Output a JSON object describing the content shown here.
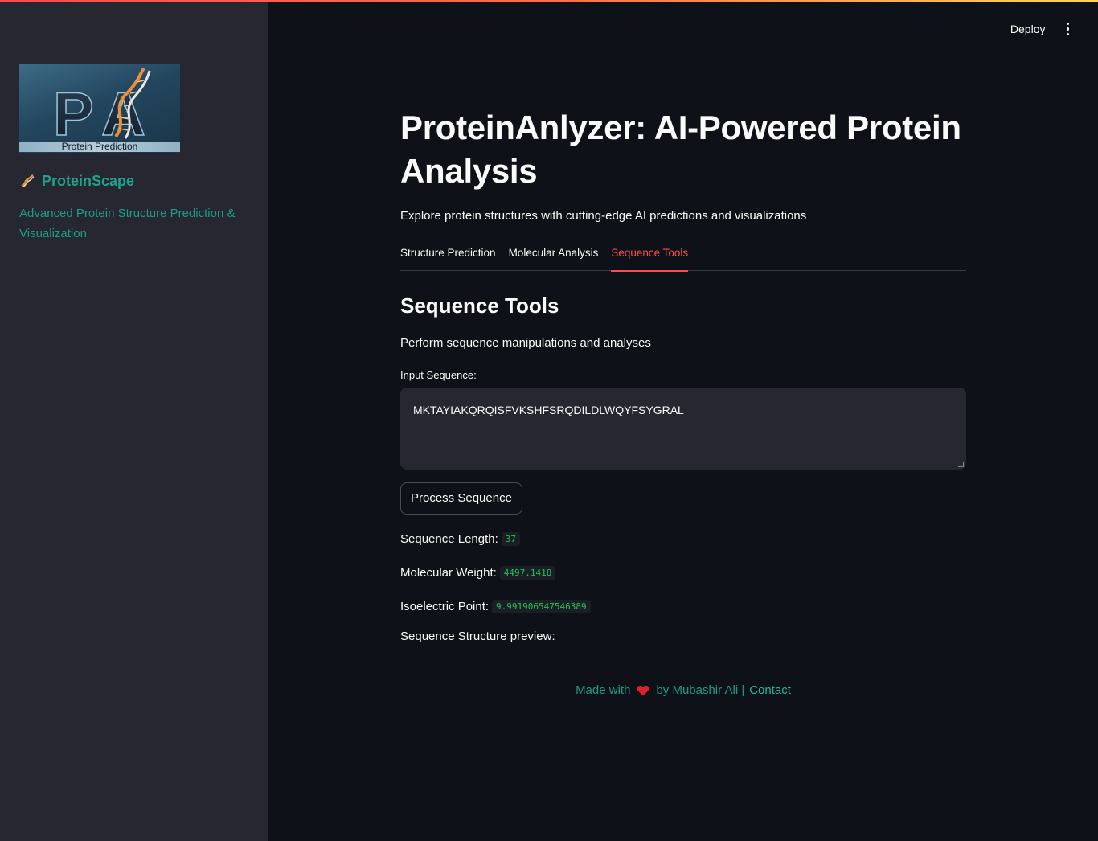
{
  "header": {
    "deploy_label": "Deploy",
    "menu_icon": "kebab-menu-icon"
  },
  "sidebar": {
    "logo_caption": "Protein Prediction",
    "logo_letters": "PA",
    "brand_icon": "dna-icon",
    "brand_name": "ProteinScape",
    "tagline": "Advanced Protein Structure Prediction & Visualization"
  },
  "main": {
    "title": "ProteinAnlyzer: AI-Powered Protein Analysis",
    "subtitle": "Explore protein structures with cutting-edge AI predictions and visualizations",
    "tabs": [
      {
        "label": "Structure Prediction",
        "active": false
      },
      {
        "label": "Molecular Analysis",
        "active": false
      },
      {
        "label": "Sequence Tools",
        "active": true
      }
    ],
    "section_title": "Sequence Tools",
    "section_subtitle": "Perform sequence manipulations and analyses",
    "input_label": "Input Sequence:",
    "input_value": "MKTAYIAKQRQISFVKSHFSRQDILDLWQYFSYGRAL",
    "process_button": "Process Sequence",
    "stats": {
      "length_label": "Sequence Length:",
      "length_value": "37",
      "weight_label": "Molecular Weight:",
      "weight_value": "4497.1418",
      "pi_label": "Isoelectric Point:",
      "pi_value": "9.991906547546389"
    },
    "preview_label": "Sequence Structure preview:"
  },
  "footer": {
    "made_with": "Made with",
    "heart_icon": "heart-icon",
    "by_text": "by Mubashir Ali |",
    "contact_label": "Contact"
  },
  "colors": {
    "background": "#0e1117",
    "sidebar": "#262730",
    "accent": "#ff4b4b",
    "teal": "#21a08a",
    "code_green": "#21c354"
  }
}
